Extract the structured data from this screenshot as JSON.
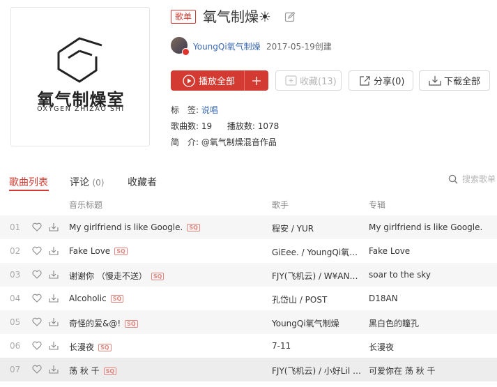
{
  "cover": {
    "title": "氧气制燥室",
    "subtitle": "OXYGEN ZHIZAO SHI"
  },
  "header": {
    "badge": "歌单",
    "title": "氧气制燥☀",
    "creator": "YoungQi氧气制燥",
    "created": "2017-05-19创建"
  },
  "actions": {
    "play_all": "播放全部",
    "favorite": "收藏(13)",
    "share": "分享(0)",
    "download_all": "下载全部"
  },
  "meta": {
    "tags_label": "标　签:",
    "tag": "说唱",
    "songs_label": "歌曲数:",
    "songs_count": "19",
    "plays_label": "播放数:",
    "plays_count": "1078",
    "intro_label": "简　介:",
    "intro": "@氧气制燥混音作品"
  },
  "tabs": {
    "songs": "歌曲列表",
    "comments": "评论",
    "comments_count": "(0)",
    "collectors": "收藏者"
  },
  "search": {
    "placeholder": "搜索歌单"
  },
  "table": {
    "headers": {
      "title": "音乐标题",
      "singer": "歌手",
      "album": "专辑"
    },
    "sq_label": "SQ",
    "rows": [
      {
        "index": "01",
        "title": "My girlfriend is like Google.",
        "singer": "程安 / YUR",
        "album": "My girlfriend is like Google."
      },
      {
        "index": "02",
        "title": "Fake Love",
        "singer": "GiEee. / YoungQi氧气…",
        "album": "Fake Love"
      },
      {
        "index": "03",
        "title": "谢谢你 （慢走不送）",
        "singer": "FJY(飞机云) / W¥AN…",
        "album": "soar to the sky"
      },
      {
        "index": "04",
        "title": "Alcoholic",
        "singer": "孔岱山 / POST",
        "album": "D18AN"
      },
      {
        "index": "05",
        "title": "奇怪的爱&@!",
        "singer": "YoungQi氧气制燥",
        "album": "黑白色的瞳孔"
      },
      {
        "index": "06",
        "title": "长漫夜",
        "singer": "7-11",
        "album": "长漫夜"
      },
      {
        "index": "07",
        "title": "荡 秋 千",
        "singer": "FJY(飞机云) / 小好Lil …",
        "album": "可爱你在 荡 秋 千"
      }
    ]
  },
  "colors": {
    "accent": "#d33a31",
    "link": "#3c6ab3"
  }
}
